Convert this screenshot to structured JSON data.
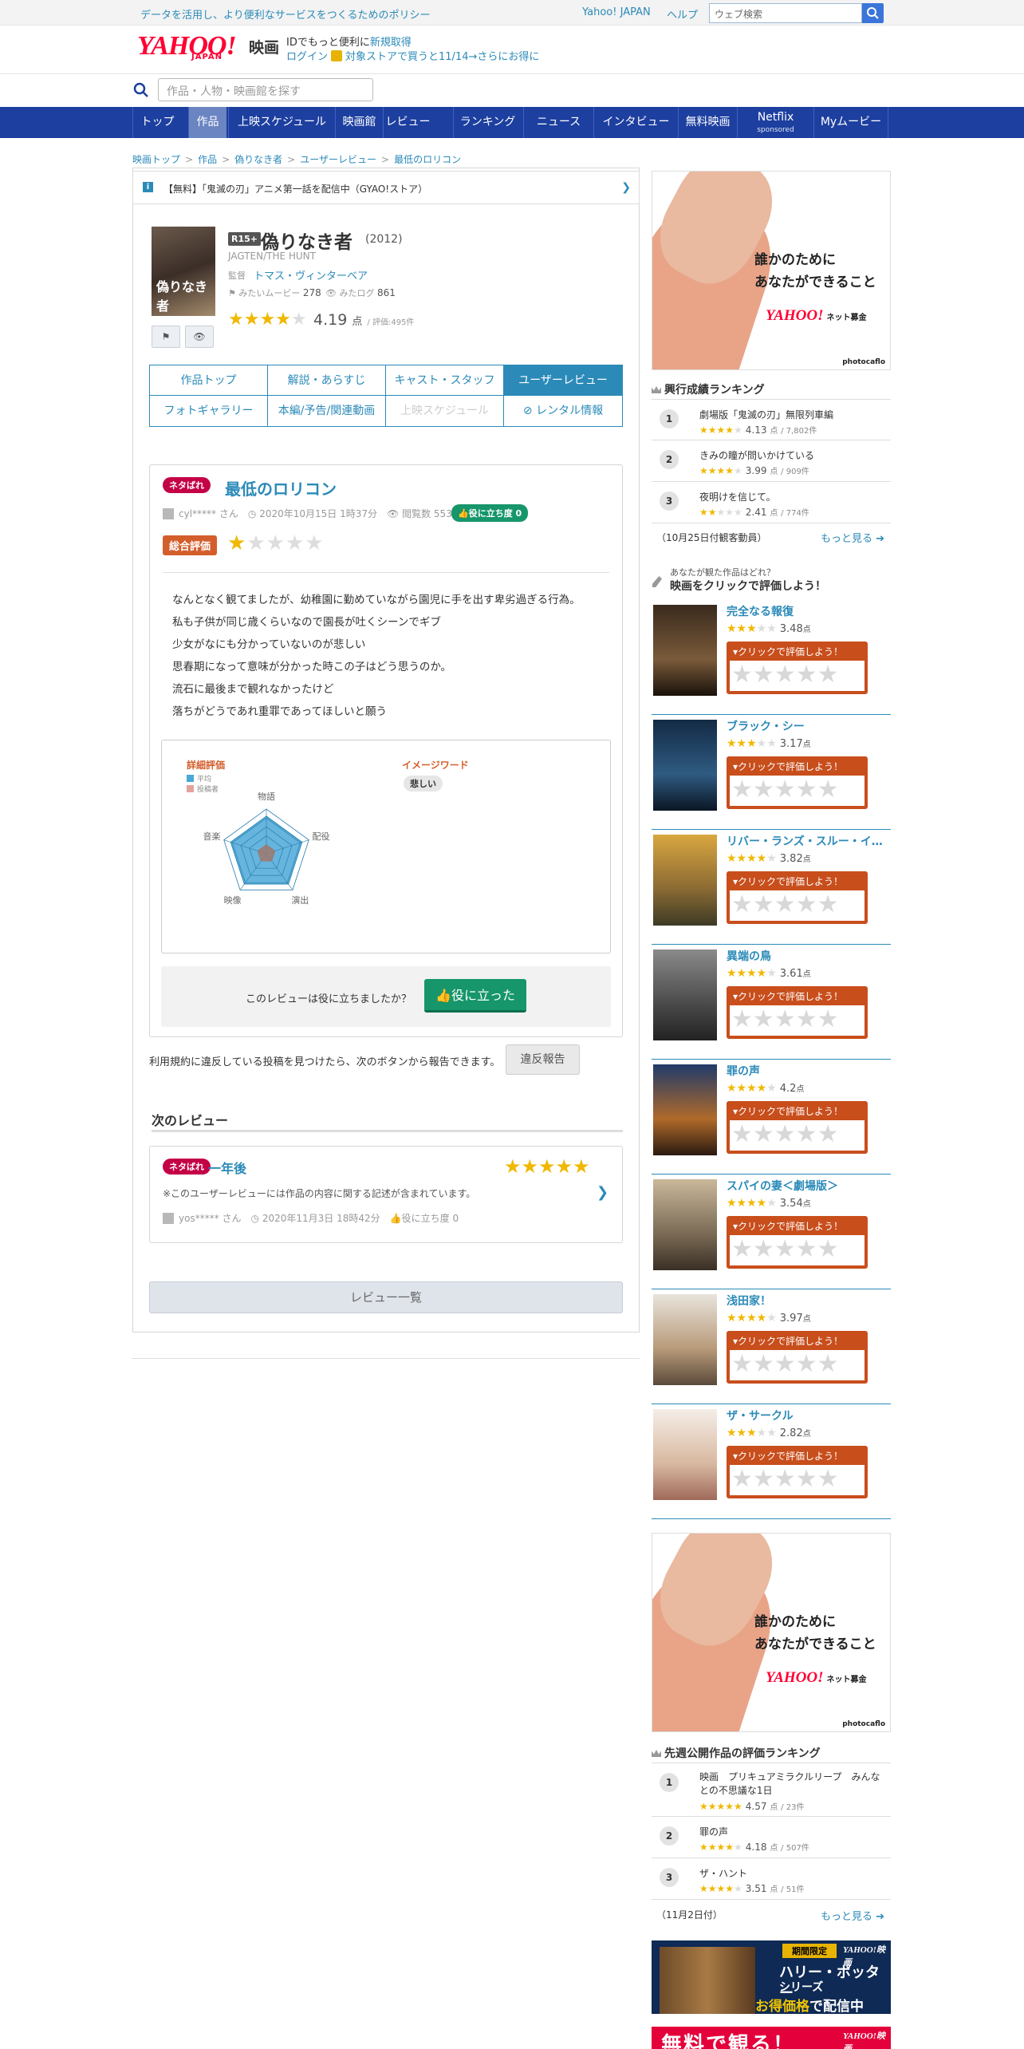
{
  "topbar": {
    "policy": "データを活用し、より便利なサービスをつくるためのポリシー",
    "yahoo_japan": "Yahoo! JAPAN",
    "help": "ヘルプ",
    "search_placeholder": "ウェブ検索"
  },
  "header": {
    "logo": "YAHOO!",
    "logo_sub": "JAPAN",
    "section": "映画",
    "msg1_prefix": "IDでもっと便利に",
    "msg1_link": "新規取得",
    "login": "ログイン",
    "store_msg": "対象ストアで買うと11/14→さらにお得に"
  },
  "movie_search": {
    "placeholder": "作品・人物・映画館を探す"
  },
  "nav": [
    {
      "label": "トップ"
    },
    {
      "label": "作品"
    },
    {
      "label": "上映スケジュール"
    },
    {
      "label": "映画館"
    },
    {
      "label": "レビュー"
    },
    {
      "label": "ランキング"
    },
    {
      "label": "ニュース"
    },
    {
      "label": "インタビュー"
    },
    {
      "label": "無料映画"
    },
    {
      "label": "Netflix",
      "sub": "sponsored"
    },
    {
      "label": "Myムービー"
    }
  ],
  "breadcrumb": [
    "映画トップ",
    "作品",
    "偽りなき者",
    "ユーザーレビュー",
    "最低のロリコン"
  ],
  "notice": {
    "icon": "i",
    "text": "【無料】「鬼滅の刃」アニメ第一話を配信中（GYAO!ストア）"
  },
  "movie": {
    "poster_title": "偽りなき者",
    "rating_badge": "R15+",
    "title": "偽りなき者",
    "year": "(2012)",
    "original_title": "JAGTEN/THE HUNT",
    "director_label": "監督",
    "director": "トマス・ヴィンターベア",
    "want_label": "みたいムービー",
    "want_count": "278",
    "seen_label": "みたログ",
    "seen_count": "861",
    "stars": "★★★★",
    "stars_off": "★",
    "score": "4.19",
    "score_unit": "点",
    "review_count": "/ 評価:495件"
  },
  "tabs": [
    {
      "label": "作品トップ"
    },
    {
      "label": "解説・あらすじ"
    },
    {
      "label": "キャスト・スタッフ"
    },
    {
      "label": "ユーザーレビュー"
    },
    {
      "label": "フォトギャラリー"
    },
    {
      "label": "本編/予告/関連動画"
    },
    {
      "label": "上映スケジュール"
    },
    {
      "label": "レンタル情報"
    }
  ],
  "review": {
    "spoiler": "ネタばれ",
    "title": "最低のロリコン",
    "user": "cyl***** さん",
    "date": "2020年10月15日 1時37分",
    "views_label": "閲覧数",
    "views": "553",
    "useful": "役に立ち度 0",
    "overall_label": "総合評価",
    "stars_on": "★",
    "stars_off": "★★★★",
    "body": [
      "なんとなく観てましたが、幼稚園に勤めていながら園児に手を出す卑劣過ぎる行為。",
      "私も子供が同じ歳くらいなので園長が吐くシーンでギブ",
      "少女がなにも分かっていないのが悲しい",
      "思春期になって意味が分かった時この子はどう思うのか。",
      "流石に最後まで観れなかったけど",
      "落ちがどうであれ重罪であってほしいと願う"
    ],
    "detail_label": "詳細評価",
    "legend_avg": "平均",
    "legend_poster": "投稿者",
    "image_word_label": "イメージワード",
    "image_word": "悲しい",
    "axes": [
      "物語",
      "配役",
      "演出",
      "映像",
      "音楽"
    ],
    "avg_scores": [
      4.2,
      4.2,
      4.2,
      4.2,
      4.2
    ],
    "poster_scores": [
      1,
      1,
      1,
      1,
      1
    ],
    "helpful_question": "このレビューは役に立ちましたか？",
    "helpful_button": "役に立った",
    "report_text": "利用規約に違反している投稿を見つけたら、次のボタンから報告できます。",
    "report_button": "違反報告"
  },
  "next": {
    "heading": "次のレビュー",
    "spoiler": "ネタばれ",
    "title": "一年後",
    "stars": "★★★★★",
    "note": "※このユーザーレビューには作品の内容に関する記述が含まれています。",
    "user": "yos***** さん",
    "date": "2020年11月3日 18時42分",
    "useful": "役に立ち度 0"
  },
  "list_button": "レビュー一覧",
  "ad": {
    "line1": "誰かのために",
    "line2": "あなたができること",
    "logo": "YAHOO!",
    "logo_sub": "ネット募金",
    "credit": "photocaflo"
  },
  "box_office": {
    "heading": "興行成績ランキング",
    "rows": [
      {
        "rank": "1",
        "title": "劇場版「鬼滅の刃」無限列車編",
        "stars": "★★★★",
        "stars_off": "★",
        "score": "4.13",
        "unit": "点",
        "count": "/ 7,802件"
      },
      {
        "rank": "2",
        "title": "きみの瞳が問いかけている",
        "stars": "★★★★",
        "stars_off": "★",
        "score": "3.99",
        "unit": "点",
        "count": "/ 909件"
      },
      {
        "rank": "3",
        "title": "夜明けを信じて。",
        "stars": "★★",
        "stars_off": "★★★",
        "score": "2.41",
        "unit": "点",
        "count": "/ 774件"
      }
    ],
    "note": "（10月25日付観客動員）",
    "more": "もっと見る"
  },
  "evaluate": {
    "q": "あなたが観た作品はどれ？",
    "heading": "映画をクリックで評価しよう！",
    "click_label": "▾クリックで評価しよう！",
    "empty_stars": "★★★★★",
    "items": [
      {
        "title": "完全なる報復",
        "stars": "★★★",
        "stars_off": "★★",
        "score": "3.48",
        "unit": "点"
      },
      {
        "title": "ブラック・シー",
        "stars": "★★★",
        "stars_off": "★★",
        "score": "3.17",
        "unit": "点"
      },
      {
        "title": "リバー・ランズ・スルー・イ…",
        "stars": "★★★★",
        "stars_off": "★",
        "score": "3.82",
        "unit": "点"
      },
      {
        "title": "異端の鳥",
        "stars": "★★★★",
        "stars_off": "★",
        "score": "3.61",
        "unit": "点"
      },
      {
        "title": "罪の声",
        "stars": "★★★★",
        "stars_off": "★",
        "score": "4.2",
        "unit": "点"
      },
      {
        "title": "スパイの妻＜劇場版＞",
        "stars": "★★★★",
        "stars_off": "★",
        "score": "3.54",
        "unit": "点"
      },
      {
        "title": "浅田家！",
        "stars": "★★★★",
        "stars_off": "★",
        "score": "3.97",
        "unit": "点"
      },
      {
        "title": "ザ・サークル",
        "stars": "★★★",
        "stars_off": "★★",
        "score": "2.82",
        "unit": "点"
      }
    ]
  },
  "preview": {
    "heading": "先週公開作品の評価ランキング",
    "rows": [
      {
        "rank": "1",
        "title": "映画　プリキュアミラクルリープ　みんなとの不思議な1日",
        "stars": "★★★★★",
        "stars_off": "",
        "score": "4.57",
        "unit": "点",
        "count": "/ 23件"
      },
      {
        "rank": "2",
        "title": "罪の声",
        "stars": "★★★★",
        "stars_off": "★",
        "score": "4.18",
        "unit": "点",
        "count": "/ 507件"
      },
      {
        "rank": "3",
        "title": "ザ・ハント",
        "stars": "★★★★",
        "stars_off": "★",
        "score": "3.51",
        "unit": "点",
        "count": "/ 51件"
      }
    ],
    "note": "（11月2日付）",
    "more": "もっと見る"
  },
  "hp_ad": {
    "tag": "期間限定",
    "line1": "ハリー・ポッター",
    "line2": "シリーズ",
    "line3a": "お得価格",
    "line3b": "で配信中",
    "logo": "YAHOO!映画"
  },
  "free_ad": {
    "text": "無料で観る！",
    "logo": "YAHOO!映画"
  },
  "colors": {
    "nav": "#1d3fa0",
    "link": "#2b8ab8",
    "star": "#f0b800",
    "spoiler": "#c40046",
    "useful": "#16966a",
    "overall": "#d35e2c"
  }
}
